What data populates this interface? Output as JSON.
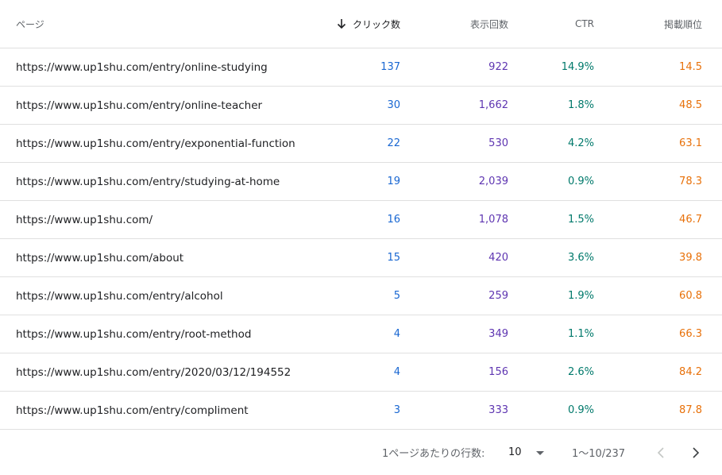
{
  "header": {
    "page": "ページ",
    "clicks": "クリック数",
    "impressions": "表示回数",
    "ctr": "CTR",
    "position": "掲載順位",
    "sort_icon": "arrow-down-icon"
  },
  "rows": [
    {
      "page": "https://www.up1shu.com/entry/online-studying",
      "clicks": "137",
      "impressions": "922",
      "ctr": "14.9%",
      "position": "14.5"
    },
    {
      "page": "https://www.up1shu.com/entry/online-teacher",
      "clicks": "30",
      "impressions": "1,662",
      "ctr": "1.8%",
      "position": "48.5"
    },
    {
      "page": "https://www.up1shu.com/entry/exponential-function",
      "clicks": "22",
      "impressions": "530",
      "ctr": "4.2%",
      "position": "63.1"
    },
    {
      "page": "https://www.up1shu.com/entry/studying-at-home",
      "clicks": "19",
      "impressions": "2,039",
      "ctr": "0.9%",
      "position": "78.3"
    },
    {
      "page": "https://www.up1shu.com/",
      "clicks": "16",
      "impressions": "1,078",
      "ctr": "1.5%",
      "position": "46.7"
    },
    {
      "page": "https://www.up1shu.com/about",
      "clicks": "15",
      "impressions": "420",
      "ctr": "3.6%",
      "position": "39.8"
    },
    {
      "page": "https://www.up1shu.com/entry/alcohol",
      "clicks": "5",
      "impressions": "259",
      "ctr": "1.9%",
      "position": "60.8"
    },
    {
      "page": "https://www.up1shu.com/entry/root-method",
      "clicks": "4",
      "impressions": "349",
      "ctr": "1.1%",
      "position": "66.3"
    },
    {
      "page": "https://www.up1shu.com/entry/2020/03/12/194552",
      "clicks": "4",
      "impressions": "156",
      "ctr": "2.6%",
      "position": "84.2"
    },
    {
      "page": "https://www.up1shu.com/entry/compliment",
      "clicks": "3",
      "impressions": "333",
      "ctr": "0.9%",
      "position": "87.8"
    }
  ],
  "footer": {
    "rows_per_page_label": "1ページあたりの行数:",
    "rows_per_page_value": "10",
    "range": "1〜10/237",
    "prev_icon": "chevron-left-icon",
    "next_icon": "chevron-right-icon"
  },
  "colors": {
    "clicks": "#1967d2",
    "impressions": "#5e35b1",
    "ctr": "#00796b",
    "position": "#e8710a"
  }
}
